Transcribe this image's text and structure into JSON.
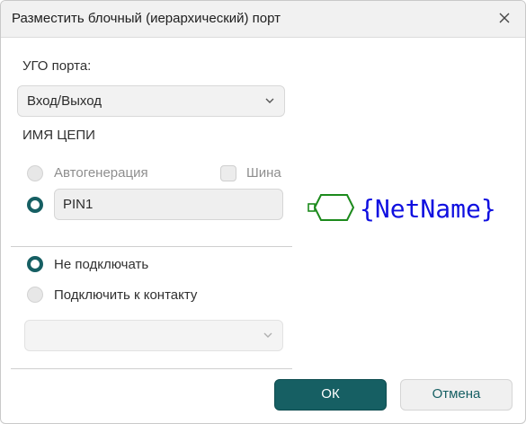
{
  "dialog": {
    "title": "Разместить блочный (иерархический) порт",
    "close_icon": "close-icon"
  },
  "port_symbol": {
    "label": "УГО порта:",
    "selected": "Вход/Выход"
  },
  "net_name": {
    "heading": "ИМЯ ЦЕПИ",
    "autogen_label": "Автогенерация",
    "bus_label": "Шина",
    "name_value": "PIN1",
    "selected_option": "manual"
  },
  "connection": {
    "option_none": "Не подключать",
    "option_pin": "Подключить к контакту",
    "selected_option": "none",
    "pin_select_value": ""
  },
  "preview": {
    "text": "{NetName}",
    "colors": {
      "port_outline": "#1c8a1c",
      "net_text": "#1010e0"
    }
  },
  "buttons": {
    "ok": "ОК",
    "cancel": "Отмена"
  },
  "colors": {
    "accent": "#165f63"
  }
}
